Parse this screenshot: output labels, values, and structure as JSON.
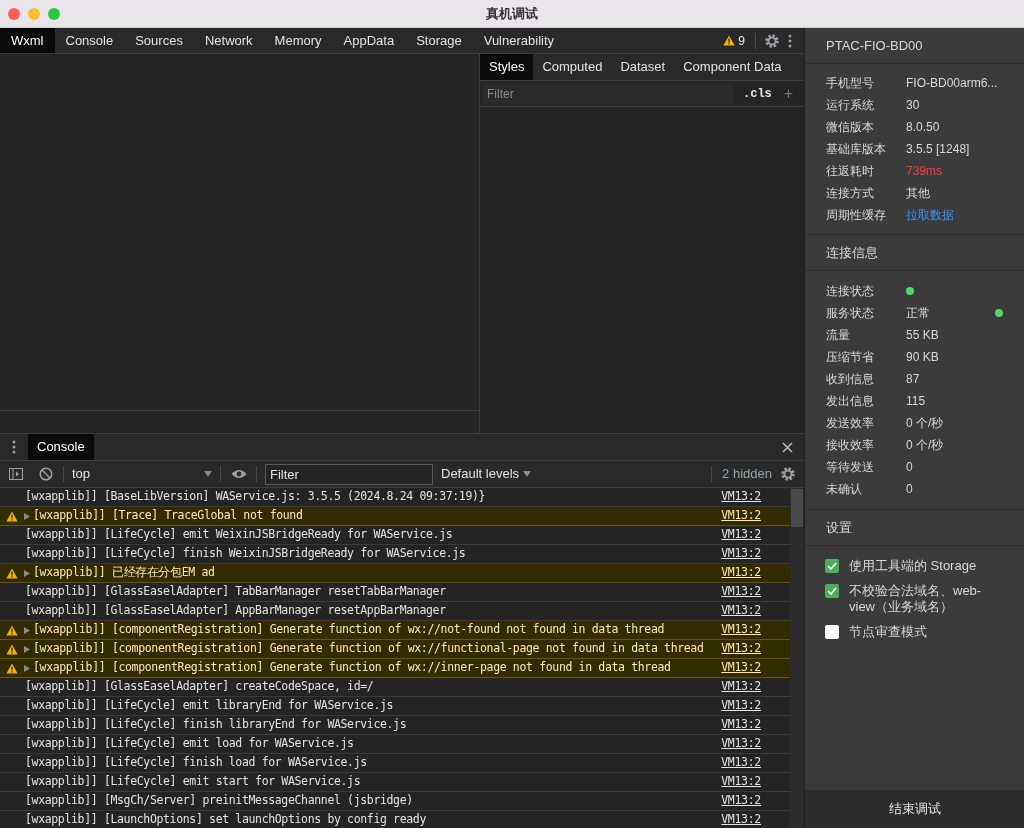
{
  "window": {
    "title": "真机调试"
  },
  "devtools_tabs": [
    {
      "label": "Wxml",
      "selected": true
    },
    {
      "label": "Console",
      "selected": false
    },
    {
      "label": "Sources",
      "selected": false
    },
    {
      "label": "Network",
      "selected": false
    },
    {
      "label": "Memory",
      "selected": false
    },
    {
      "label": "AppData",
      "selected": false
    },
    {
      "label": "Storage",
      "selected": false
    },
    {
      "label": "Vulnerability",
      "selected": false
    }
  ],
  "warning_count": "9",
  "styles_tabs": [
    {
      "label": "Styles",
      "selected": true
    },
    {
      "label": "Computed",
      "selected": false
    },
    {
      "label": "Dataset",
      "selected": false
    },
    {
      "label": "Component Data",
      "selected": false
    }
  ],
  "styles_filter": {
    "placeholder": "Filter"
  },
  "cls_button": ".cls",
  "plus_button": "+",
  "drawer_tabs": [
    {
      "label": "Console",
      "selected": true
    }
  ],
  "console_toolbar": {
    "context": "top",
    "filter": {
      "placeholder": "Filter"
    },
    "levels": "Default levels",
    "hidden": "2 hidden"
  },
  "logs": [
    {
      "kind": "log",
      "text": "[wxapplib]] [BaseLibVersion] WAService.js: 3.5.5 (2024.8.24 09:37:19)}",
      "source": "VM13:2"
    },
    {
      "kind": "warn",
      "text": "[wxapplib]] [Trace] TraceGlobal not found",
      "source": "VM13:2"
    },
    {
      "kind": "log",
      "text": "[wxapplib]] [LifeCycle] emit WeixinJSBridgeReady for WAService.js",
      "source": "VM13:2"
    },
    {
      "kind": "log",
      "text": "[wxapplib]] [LifeCycle] finish WeixinJSBridgeReady for WAService.js",
      "source": "VM13:2"
    },
    {
      "kind": "warn",
      "text": "[wxapplib]] 已经存在分包EM ad",
      "source": "VM13:2"
    },
    {
      "kind": "log",
      "text": "[wxapplib]] [GlassEaselAdapter] TabBarManager resetTabBarManager",
      "source": "VM13:2"
    },
    {
      "kind": "log",
      "text": "[wxapplib]] [GlassEaselAdapter] AppBarManager resetAppBarManager",
      "source": "VM13:2"
    },
    {
      "kind": "warn",
      "text": "[wxapplib]] [componentRegistration] Generate function of wx://not-found not found in data thread",
      "source": "VM13:2"
    },
    {
      "kind": "warn",
      "text": "[wxapplib]] [componentRegistration] Generate function of wx://functional-page not found in data thread",
      "source": "VM13:2"
    },
    {
      "kind": "warn",
      "text": "[wxapplib]] [componentRegistration] Generate function of wx://inner-page not found in data thread",
      "source": "VM13:2"
    },
    {
      "kind": "log",
      "text": "[wxapplib]] [GlassEaselAdapter] createCodeSpace, id=/",
      "source": "VM13:2"
    },
    {
      "kind": "log",
      "text": "[wxapplib]] [LifeCycle] emit libraryEnd for WAService.js",
      "source": "VM13:2"
    },
    {
      "kind": "log",
      "text": "[wxapplib]] [LifeCycle] finish libraryEnd for WAService.js",
      "source": "VM13:2"
    },
    {
      "kind": "log",
      "text": "[wxapplib]] [LifeCycle] emit load for WAService.js",
      "source": "VM13:2"
    },
    {
      "kind": "log",
      "text": "[wxapplib]] [LifeCycle] finish load for WAService.js",
      "source": "VM13:2"
    },
    {
      "kind": "log",
      "text": "[wxapplib]] [LifeCycle] emit start for WAService.js",
      "source": "VM13:2"
    },
    {
      "kind": "log",
      "text": "[wxapplib]] [MsgCh/Server] preinitMessageChannel (jsbridge)",
      "source": "VM13:2"
    },
    {
      "kind": "log",
      "text": "[wxapplib]] [LaunchOptions] set launchOptions by config ready",
      "source": "VM13:2"
    }
  ],
  "device": {
    "name": "PTAC-FIO-BD00",
    "rows": [
      {
        "kind": "text",
        "label": "手机型号",
        "value": "FIO-BD00arm6..."
      },
      {
        "kind": "text",
        "label": "运行系统",
        "value": "30"
      },
      {
        "kind": "text",
        "label": "微信版本",
        "value": "8.0.50"
      },
      {
        "kind": "text",
        "label": "基础库版本",
        "value": "3.5.5 [1248]"
      },
      {
        "kind": "alert",
        "label": "往返耗时",
        "value": "739ms"
      },
      {
        "kind": "text",
        "label": "连接方式",
        "value": "其他"
      },
      {
        "kind": "link",
        "label": "周期性缓存",
        "value": "拉取数据"
      }
    ]
  },
  "connection": {
    "title": "连接信息",
    "rows": [
      {
        "kind": "status",
        "label": "连接状态",
        "color": "#4cd964"
      },
      {
        "kind": "text_status",
        "label": "服务状态",
        "value": "正常",
        "color": "#4cd964"
      },
      {
        "kind": "text",
        "label": "流量",
        "value": "55 KB"
      },
      {
        "kind": "text",
        "label": "压缩节省",
        "value": "90 KB"
      },
      {
        "kind": "text",
        "label": "收到信息",
        "value": "87"
      },
      {
        "kind": "text",
        "label": "发出信息",
        "value": "115"
      },
      {
        "kind": "text",
        "label": "发送效率",
        "value": "0 个/秒"
      },
      {
        "kind": "text",
        "label": "接收效率",
        "value": "0 个/秒"
      },
      {
        "kind": "text",
        "label": "等待发送",
        "value": "0"
      },
      {
        "kind": "text",
        "label": "未确认",
        "value": "0"
      }
    ]
  },
  "settings": {
    "title": "设置",
    "options": [
      {
        "label": "使用工具端的 Storage",
        "checked": true
      },
      {
        "label": "不校验合法域名、web-view（业务域名）",
        "checked": true
      },
      {
        "label": "节点审查模式",
        "checked": false
      }
    ]
  },
  "end_button": "结束调试"
}
